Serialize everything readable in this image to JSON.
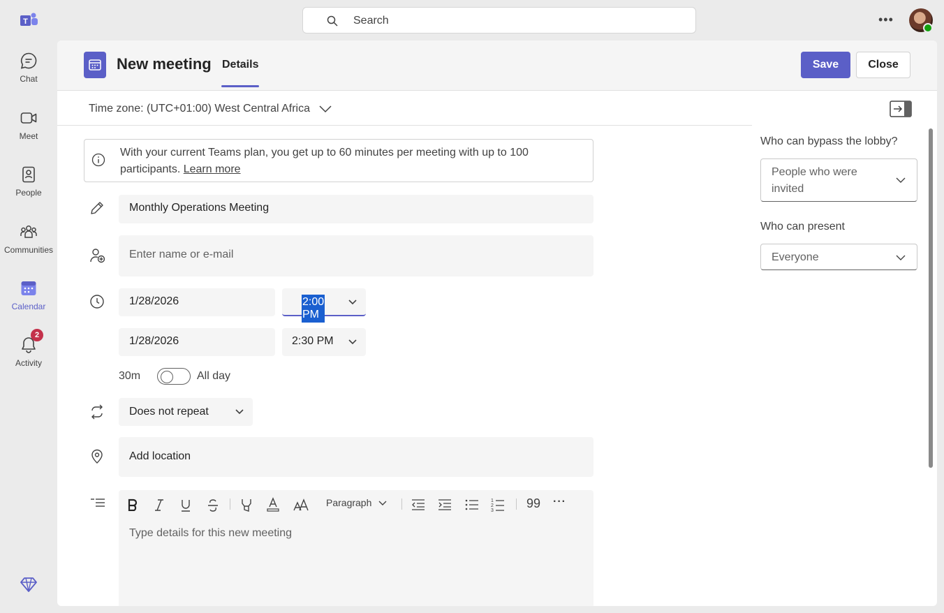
{
  "rail": {
    "items": [
      {
        "label": "Chat",
        "icon": "chat-icon"
      },
      {
        "label": "Meet",
        "icon": "video-icon"
      },
      {
        "label": "People",
        "icon": "people-icon"
      },
      {
        "label": "Communities",
        "icon": "communities-icon"
      },
      {
        "label": "Calendar",
        "icon": "calendar-icon",
        "active": true
      },
      {
        "label": "Activity",
        "icon": "bell-icon",
        "badge": "2"
      }
    ]
  },
  "search": {
    "placeholder": "Search"
  },
  "header": {
    "title": "New meeting",
    "tab": "Details",
    "save_label": "Save",
    "close_label": "Close"
  },
  "timezone": "Time zone: (UTC+01:00) West Central Africa",
  "info": {
    "text": "With your current Teams plan, you get up to 60 minutes per meeting with up to 100 participants.",
    "link": "Learn more"
  },
  "form": {
    "title_value": "Monthly Operations Meeting",
    "attendees_placeholder": "Enter name or e-mail",
    "start_date": "1/28/2026",
    "start_time": "2:00 PM",
    "end_date": "1/28/2026",
    "end_time": "2:30 PM",
    "duration": "30m",
    "all_day_label": "All day",
    "repeat": "Does not repeat",
    "location_placeholder": "Add location",
    "details_placeholder": "Type details for this new meeting",
    "paragraph_style": "Paragraph"
  },
  "side": {
    "lobby_label": "Who can bypass the lobby?",
    "lobby_value": "People who were invited",
    "present_label": "Who can present",
    "present_value": "Everyone"
  },
  "colors": {
    "accent": "#5b5fc7",
    "badge": "#c4314b"
  }
}
